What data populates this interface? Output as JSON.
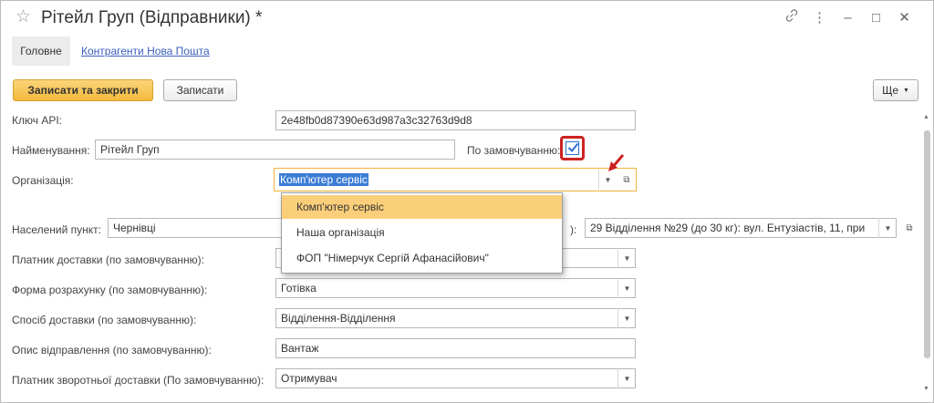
{
  "window": {
    "title": "Рітейл Груп (Відправники) *",
    "icons": [
      "star-icon",
      "link-icon",
      "more-icon",
      "minimize-icon",
      "maximize-icon",
      "close-icon"
    ]
  },
  "tabs": {
    "main": "Головне",
    "link": "Контрагенти Нова Пошта"
  },
  "toolbar": {
    "save_close": "Записати та закрити",
    "save": "Записати",
    "more": "Ще"
  },
  "form": {
    "api_key": {
      "label": "Ключ API:",
      "value": "2e48fb0d87390e63d987a3c32763d9d8"
    },
    "name": {
      "label": "Найменування:",
      "value": "Рітейл Груп"
    },
    "default": {
      "label": "По замовчуванню:",
      "checked": true
    },
    "organization": {
      "label": "Організація:",
      "value": "Комп'ютер сервіс"
    },
    "city": {
      "label": "Населений пункт:",
      "value": "Чернівці"
    },
    "branch": {
      "value": "29 Відділення №29 (до 30 кг): вул. Ентузіастів, 11, при"
    },
    "payer": {
      "label": "Платник доставки (по замовчуванню):",
      "value": ""
    },
    "payment_form": {
      "label": "Форма розрахунку (по замовчуванню):",
      "value": "Готівка"
    },
    "delivery_method": {
      "label": "Спосіб доставки (по замовчуванню):",
      "value": "Відділення-Відділення"
    },
    "description": {
      "label": "Опис відправлення (по замовчуванню):",
      "value": "Вантаж"
    },
    "return_payer": {
      "label": "Платник зворотньої доставки (По замовчуванню):",
      "value": "Отримувач"
    }
  },
  "dropdown": {
    "items": [
      "Комп'ютер сервіс",
      "Наша організація",
      "ФОП \"Німерчук Сергій Афанасійович\""
    ],
    "selected_index": 0
  },
  "colors": {
    "accent": "#f3b93b",
    "highlight_frame": "#cc2222",
    "link": "#3a5fbf",
    "selection": "#fbcf7a"
  }
}
